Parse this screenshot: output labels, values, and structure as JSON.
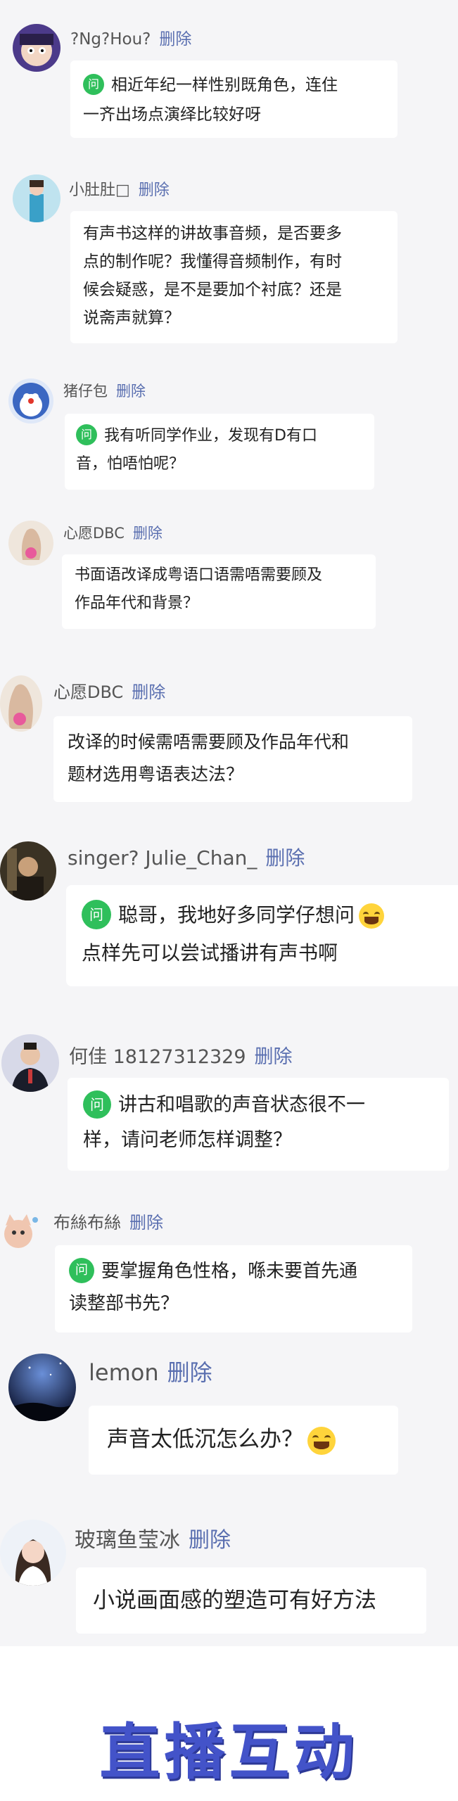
{
  "comments": [
    {
      "name": "?Ng?Hou?",
      "delete": "删除",
      "badge": "问",
      "lines": [
        "相近年纪一样性别既角色，连住",
        "一齐出场点演绎比较好呀"
      ]
    },
    {
      "name": "小肚肚□",
      "delete": "删除",
      "lines": [
        "有声书这样的讲故事音频，是否要多",
        "点的制作呢？我懂得音频制作，有时",
        "候会疑惑，是不是要加个衬底？还是",
        "说斋声就算？"
      ]
    },
    {
      "name": "猪仔包",
      "delete": "删除",
      "badge": "问",
      "lines": [
        "我有听同学作业，发现有D有口",
        "音，怕唔怕呢？"
      ]
    },
    {
      "name": "心愿DBC",
      "delete": "删除",
      "lines": [
        "书面语改译成粤语口语需唔需要顾及",
        "作品年代和背景？"
      ]
    },
    {
      "name": "心愿DBC",
      "delete": "删除",
      "lines": [
        "改译的时候需唔需要顾及作品年代和",
        "题材选用粤语表达法？"
      ]
    },
    {
      "name": "singer? Julie_Chan_",
      "delete": "删除",
      "badge": "问",
      "lines": [
        "聪哥，我地好多同学仔想问",
        "点样先可以尝试播讲有声书啊"
      ],
      "emoji": "joy-emoji"
    },
    {
      "name": "何佳 18127312329",
      "delete": "删除",
      "badge": "问",
      "lines": [
        "讲古和唱歌的声音状态很不一",
        "样，请问老师怎样调整？"
      ]
    },
    {
      "name": "布絲布絲",
      "delete": "删除",
      "badge": "问",
      "lines": [
        "要掌握角色性格，喺未要首先通",
        "读整部书先？"
      ]
    },
    {
      "name": "lemon",
      "delete": "删除",
      "lines": [
        "声音太低沉怎么办？"
      ],
      "emoji": "joy-emoji"
    },
    {
      "name": "玻璃鱼莹冰",
      "delete": "删除",
      "lines": [
        "小说画面感的塑造可有好方法"
      ]
    }
  ],
  "footer": {
    "title": "直播互动"
  },
  "colors": {
    "badge_green": "#2fbf5b",
    "delete_link": "#5a6fb0",
    "footer_title": "#4353c9",
    "background": "#f5f5f7"
  }
}
